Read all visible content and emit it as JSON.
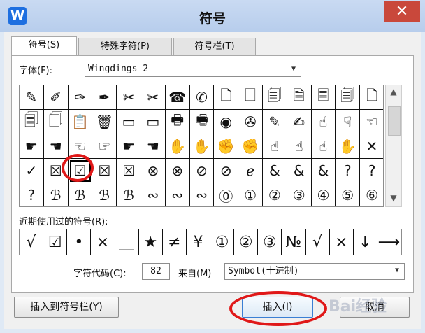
{
  "window": {
    "title": "符号",
    "app_icon": "W",
    "close_label": "✕"
  },
  "tabs": [
    {
      "label": "符号(S)"
    },
    {
      "label": "特殊字符(P)"
    },
    {
      "label": "符号栏(T)"
    }
  ],
  "font": {
    "label": "字体(F):",
    "value": "Wingdings 2",
    "arrow": "▼"
  },
  "grid": {
    "cells": [
      "✎",
      "✐",
      "✑",
      "✒",
      "✂",
      "✂",
      "☎",
      "✆",
      "🗋",
      "🗌",
      "🗐",
      "🗎",
      "🗏",
      "🗐",
      "🗋",
      "🗐",
      "🗍",
      "📋",
      "🗑",
      "▭",
      "▭",
      "🖶",
      "🖷",
      "◉",
      "✇",
      "✎",
      "✍",
      "☝",
      "☟",
      "☜",
      "☛",
      "☚",
      "☜",
      "☞",
      "☛",
      "☚",
      "✋",
      "✋",
      "✊",
      "✊",
      "☝",
      "☝",
      "☝",
      "✋",
      "✕",
      "✓",
      "☒",
      "☑",
      "☒",
      "☒",
      "⊗",
      "⊗",
      "⊘",
      "⊘",
      "ℯ",
      "&",
      "&",
      "&",
      "?",
      "?",
      "?",
      "ℬ",
      "ℬ",
      "ℬ",
      "ℬ",
      "∾",
      "∾",
      "∾",
      "⓪",
      "①",
      "②",
      "③",
      "④",
      "⑤",
      "⑥"
    ],
    "selected_index": 47
  },
  "scroll": {
    "up": "▲",
    "down": "▼"
  },
  "recent": {
    "label": "近期使用过的符号(R):",
    "symbols": [
      "√",
      "☑",
      "•",
      "×",
      "＿",
      "★",
      "≠",
      "¥",
      "①",
      "②",
      "③",
      "№",
      "√",
      "×",
      "↓",
      "⟶"
    ]
  },
  "code": {
    "label": "字符代码(C):",
    "value": "82",
    "from_label": "来自(M)",
    "source": "Symbol(十进制)",
    "arrow": "▼"
  },
  "buttons": {
    "insert_to_bar": "插入到符号栏(Y)",
    "insert": "插入(I)",
    "cancel": "取消"
  },
  "watermark": "Bai经验"
}
